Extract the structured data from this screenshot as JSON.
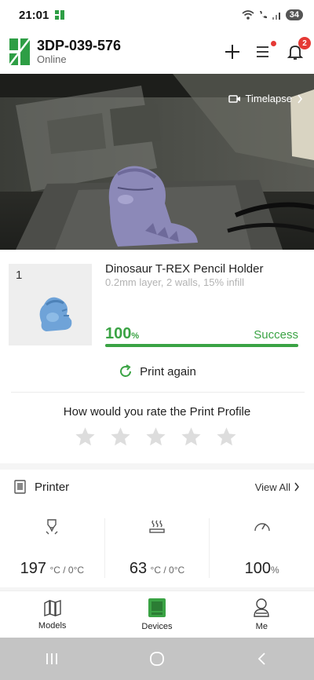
{
  "status_bar": {
    "time": "21:01",
    "battery": "34"
  },
  "header": {
    "device_name": "3DP-039-576",
    "device_status": "Online",
    "notification_count": "2"
  },
  "camera": {
    "timelapse_label": "Timelapse"
  },
  "job": {
    "plate_number": "1",
    "name": "Dinosaur T-REX Pencil Holder",
    "settings": "0.2mm layer, 2 walls, 15% infill",
    "progress_value": "100",
    "progress_unit": "%",
    "progress_fraction": 1.0,
    "status": "Success",
    "print_again_label": "Print again"
  },
  "rating": {
    "title": "How would you rate the Print Profile",
    "star_count": 5,
    "selected": 0
  },
  "printer": {
    "label": "Printer",
    "view_all_label": "View All",
    "stats": [
      {
        "icon": "nozzle-icon",
        "value": "197",
        "unit": "°C / 0°C"
      },
      {
        "icon": "heatbed-icon",
        "value": "63",
        "unit": "°C / 0°C"
      },
      {
        "icon": "speed-gauge-icon",
        "value": "100",
        "unit": "%"
      }
    ]
  },
  "bottom_nav": [
    {
      "label": "Models",
      "icon": "models-icon",
      "active": false
    },
    {
      "label": "Devices",
      "icon": "devices-icon",
      "active": true
    },
    {
      "label": "Me",
      "icon": "profile-icon",
      "active": false
    }
  ],
  "colors": {
    "accent": "#3aa344",
    "badge": "#e53935",
    "brand": "#2e9e45"
  }
}
